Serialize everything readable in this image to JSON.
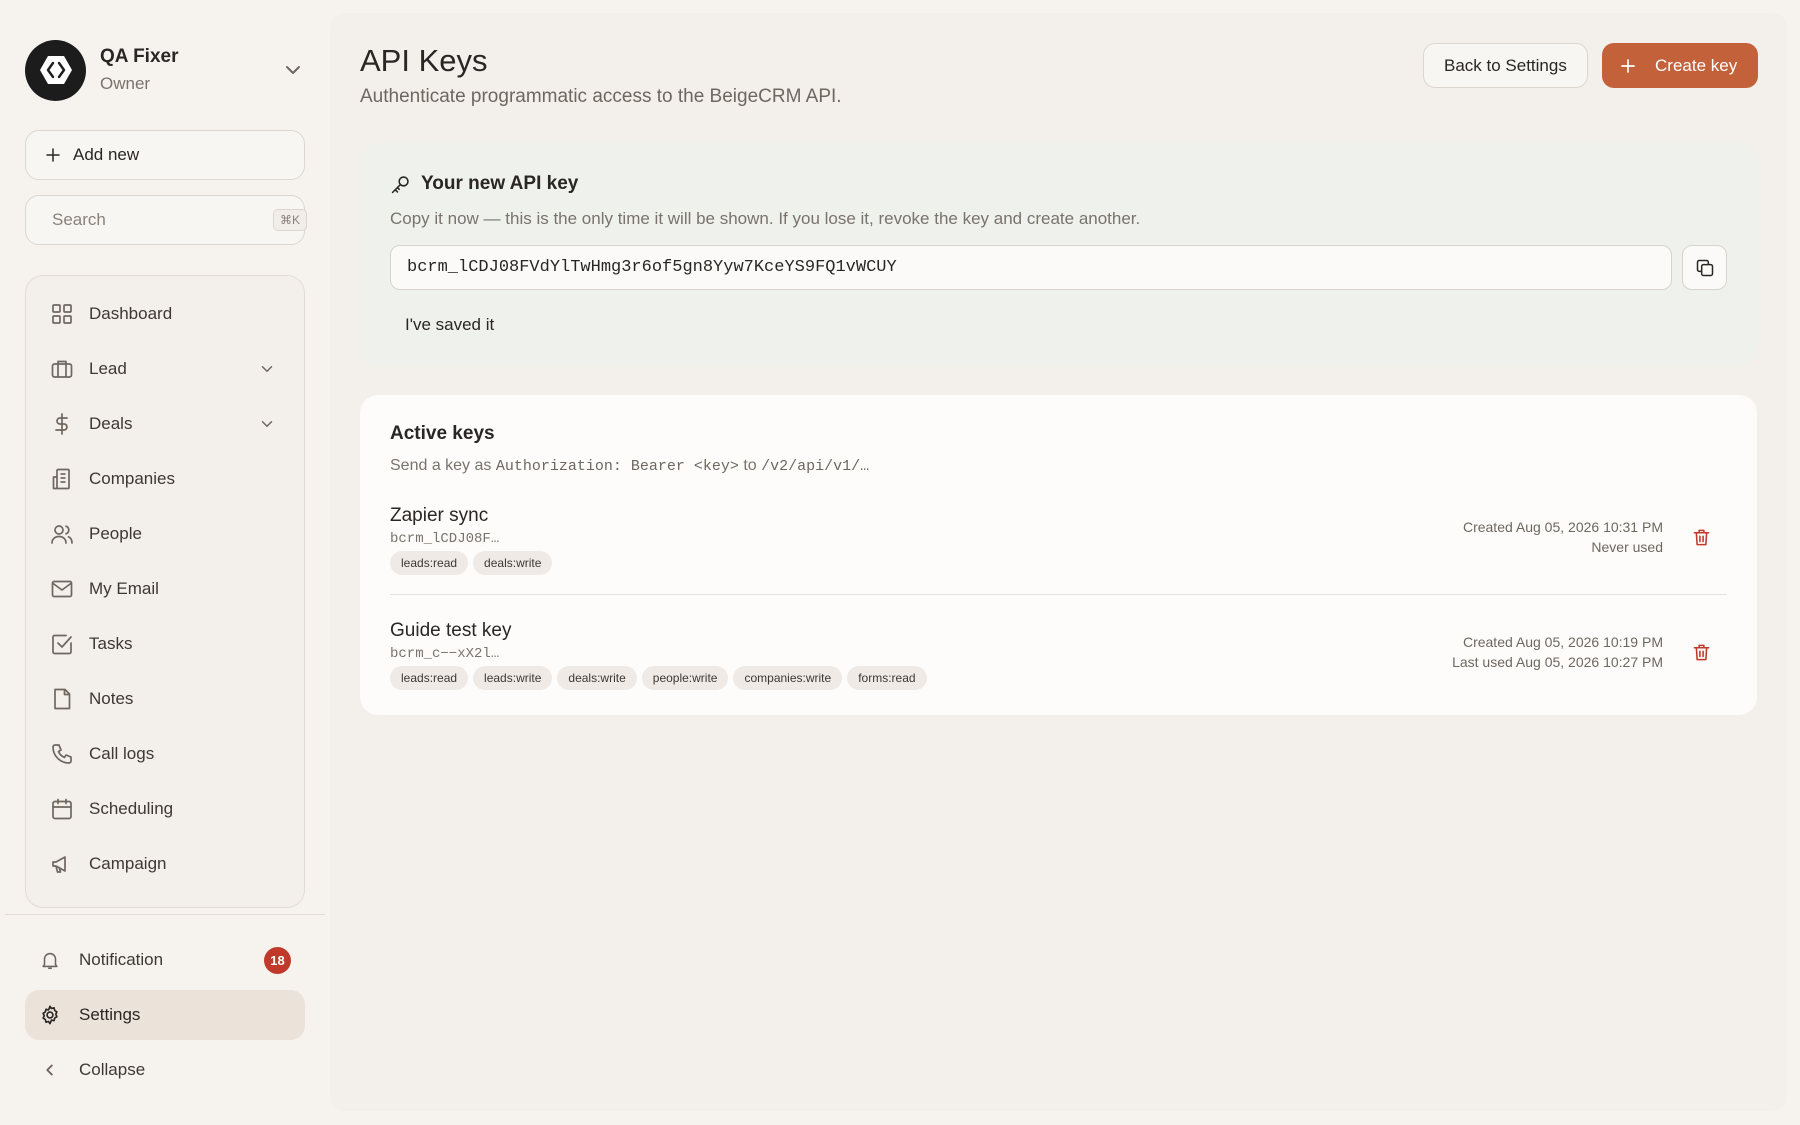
{
  "account": {
    "name": "QA Fixer",
    "role": "Owner"
  },
  "sidebar": {
    "add_new_label": "Add new",
    "search_placeholder": "Search",
    "search_shortcut": "⌘K",
    "items": [
      {
        "label": "Dashboard",
        "icon": "dashboard-icon"
      },
      {
        "label": "Lead",
        "icon": "briefcase-icon",
        "expandable": true
      },
      {
        "label": "Deals",
        "icon": "dollar-icon",
        "expandable": true
      },
      {
        "label": "Companies",
        "icon": "building-icon"
      },
      {
        "label": "People",
        "icon": "people-icon"
      },
      {
        "label": "My Email",
        "icon": "mail-icon"
      },
      {
        "label": "Tasks",
        "icon": "task-check-icon"
      },
      {
        "label": "Notes",
        "icon": "note-icon"
      },
      {
        "label": "Call logs",
        "icon": "phone-icon"
      },
      {
        "label": "Scheduling",
        "icon": "calendar-icon"
      },
      {
        "label": "Campaign",
        "icon": "megaphone-icon"
      }
    ],
    "notification_label": "Notification",
    "notification_count": "18",
    "settings_label": "Settings",
    "collapse_label": "Collapse"
  },
  "header": {
    "title": "API Keys",
    "subtitle": "Authenticate programmatic access to the BeigeCRM API.",
    "back_label": "Back to Settings",
    "create_label": "Create key"
  },
  "new_key": {
    "title": "Your new API key",
    "description": "Copy it now — this is the only time it will be shown. If you lose it, revoke the key and create another.",
    "value": "bcrm_lCDJ08FVdYlTwHmg3r6of5gn8Yyw7KceYS9FQ1vWCUY",
    "saved_label": "I've saved it"
  },
  "active_keys": {
    "title": "Active keys",
    "desc_prefix": "Send a key as",
    "desc_code1": "Authorization: Bearer <key>",
    "desc_mid": "to",
    "desc_code2": "/v2/api/v1/…",
    "keys": [
      {
        "name": "Zapier sync",
        "prefix": "bcrm_lCDJ08F…",
        "scopes": [
          "leads:read",
          "deals:write"
        ],
        "created": "Created Aug 05, 2026 10:31 PM",
        "usage": "Never used"
      },
      {
        "name": "Guide test key",
        "prefix": "bcrm_c−−xX2l…",
        "scopes": [
          "leads:read",
          "leads:write",
          "deals:write",
          "people:write",
          "companies:write",
          "forms:read"
        ],
        "created": "Created Aug 05, 2026 10:19 PM",
        "usage": "Last used Aug 05, 2026 10:27 PM"
      }
    ]
  },
  "colors": {
    "accent": "#c2613a",
    "danger": "#c03a2b",
    "background": "#f6f3ef",
    "new_key_card": "#eff1ec"
  }
}
